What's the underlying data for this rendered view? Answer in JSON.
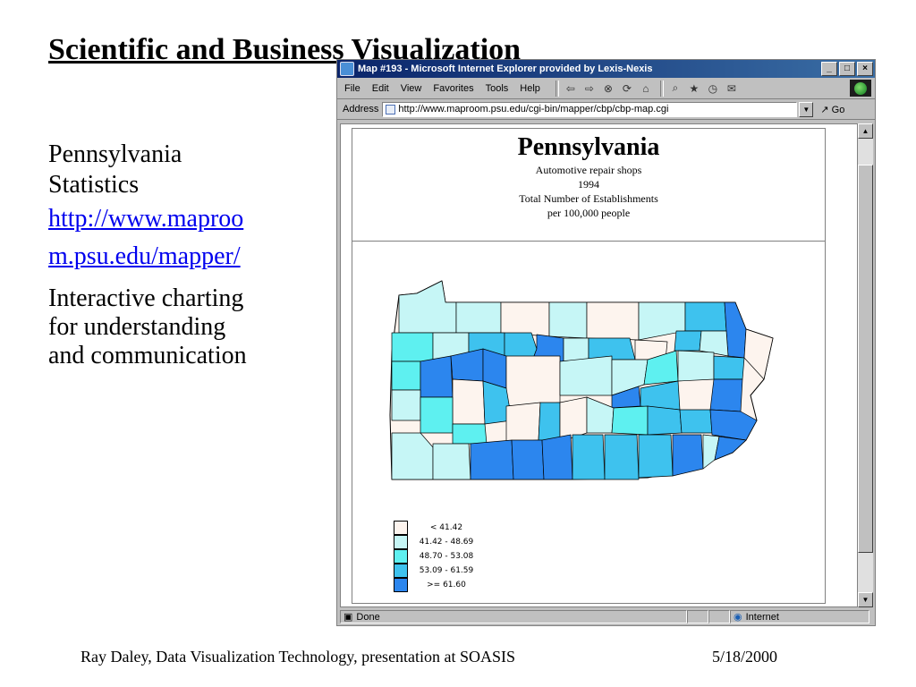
{
  "slide": {
    "title": "Scientific and Business Visualization",
    "left_lines": [
      "Pennsylvania",
      "Statistics"
    ],
    "link_text": "http://www.maproom.psu.edu/mapper/",
    "description": "Interactive charting for understanding and communication",
    "footer_left": "Ray Daley, Data Visualization Technology, presentation at SOASIS",
    "footer_right": "5/18/2000"
  },
  "browser": {
    "title": "Map #193 - Microsoft Internet Explorer provided by Lexis-Nexis",
    "window_buttons": [
      "_",
      "□",
      "×"
    ],
    "menu": [
      "File",
      "Edit",
      "View",
      "Favorites",
      "Tools",
      "Help"
    ],
    "toolbar_icons": [
      "back-icon",
      "forward-icon",
      "stop-icon",
      "refresh-icon",
      "home-icon",
      "search-icon",
      "favorites-icon",
      "history-icon",
      "mail-icon"
    ],
    "address_label": "Address",
    "address_value": "http://www.maproom.psu.edu/cgi-bin/mapper/cbp/cbp-map.cgi",
    "go_label": "Go",
    "status_text": "Done",
    "zone_text": "Internet"
  },
  "map_page": {
    "title": "Pennsylvania",
    "subtitle_lines": [
      "Automotive repair shops",
      "1994",
      "Total Number of Establishments",
      "per 100,000 people"
    ],
    "legend": [
      {
        "label": "< 41.42",
        "color": "#fdf4ee"
      },
      {
        "label": "41.42 - 48.69",
        "color": "#c6f6f6"
      },
      {
        "label": "48.70 - 53.08",
        "color": "#5ef0f0"
      },
      {
        "label": "53.09 - 61.59",
        "color": "#3ec2ee"
      },
      {
        "label": ">= 61.60",
        "color": "#2c86ee"
      }
    ]
  },
  "colors": {
    "title_bar": "#0a246a",
    "link": "#0000ee",
    "county_border": "#000000"
  }
}
